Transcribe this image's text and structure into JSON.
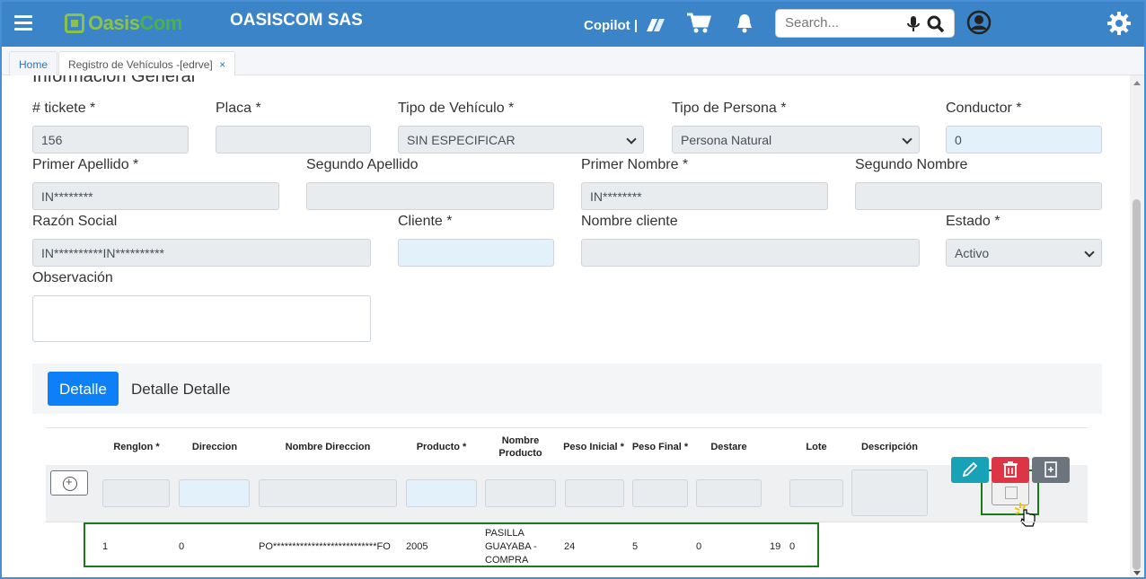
{
  "header": {
    "logo_prefix": "Oasis",
    "logo_suffix": "Com",
    "company": "OASISCOM SAS",
    "copilot": "Copilot |",
    "search_placeholder": "Search..."
  },
  "tabs": [
    {
      "label": "Home"
    },
    {
      "label": "Registro de Vehículos -[edrve]",
      "close": "×"
    }
  ],
  "form": {
    "section_title": "Información General",
    "ticket_label": "# tickete *",
    "ticket_value": "156",
    "placa_label": "Placa *",
    "placa_value": "",
    "tipo_vehiculo_label": "Tipo de Vehículo *",
    "tipo_vehiculo_value": "SIN ESPECIFICAR",
    "tipo_persona_label": "Tipo de Persona *",
    "tipo_persona_value": "Persona Natural",
    "conductor_label": "Conductor *",
    "conductor_value": "0",
    "primer_apellido_label": "Primer Apellido *",
    "primer_apellido_value": "IN********",
    "segundo_apellido_label": "Segundo Apellido",
    "primer_nombre_label": "Primer Nombre *",
    "primer_nombre_value": "IN********",
    "segundo_nombre_label": "Segundo Nombre",
    "razon_social_label": "Razón Social",
    "razon_social_value": "IN**********IN**********",
    "cliente_label": "Cliente *",
    "nombre_cliente_label": "Nombre cliente",
    "estado_label": "Estado *",
    "estado_value": "Activo",
    "observacion_label": "Observación"
  },
  "detail_tabs": [
    "Detalle",
    "Detalle Detalle"
  ],
  "table": {
    "headers": [
      "Renglon *",
      "Direccion",
      "Nombre Direccion",
      "Producto *",
      "Nombre Producto",
      "Peso Inicial *",
      "Peso Final *",
      "Destare",
      "Lote",
      "Descripción"
    ],
    "rows": [
      {
        "renglon": "1",
        "direccion": "0",
        "nombre_direccion": "PO***************************FO",
        "producto": "2005",
        "nombre_producto": "PASILLA GUAYABA - COMPRA",
        "peso_inicial": "24",
        "peso_final": "5",
        "destare": "0",
        "extra": "19",
        "lote": "0"
      }
    ]
  },
  "colors": {
    "navbar": "#3a84c7",
    "primary": "#0d7ff7",
    "edit": "#17a2b8",
    "delete": "#dc3545",
    "secondary": "#6c757d",
    "highlight": "#1a7a1a"
  }
}
